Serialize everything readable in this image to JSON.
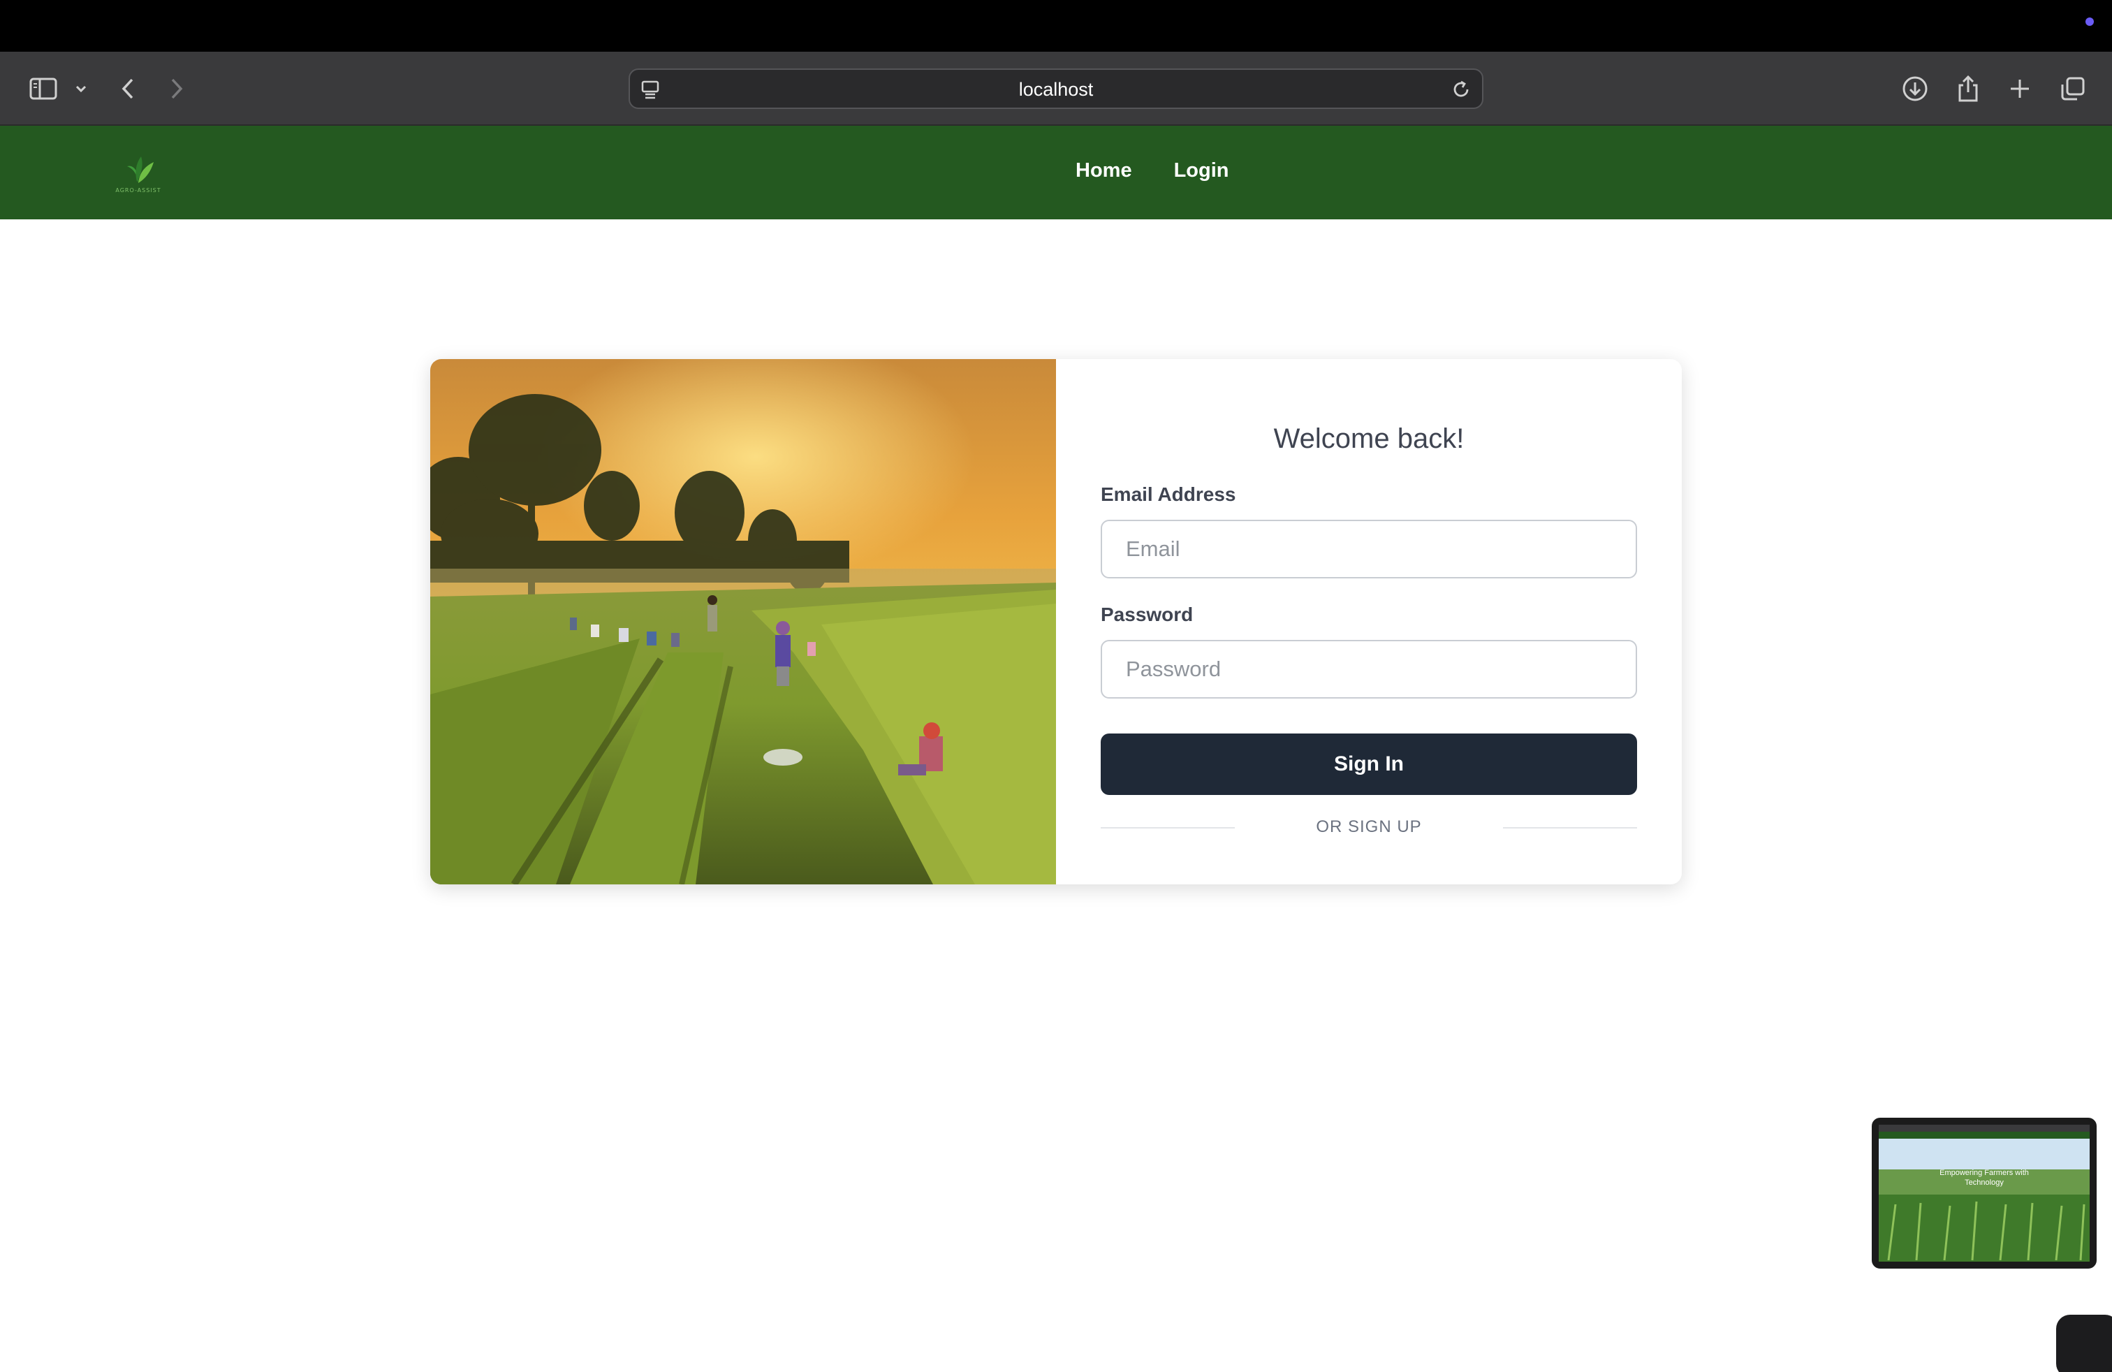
{
  "browser": {
    "url": "localhost",
    "icons": [
      "sidebar-icon",
      "chevron-down-icon",
      "back-icon",
      "forward-icon",
      "page-settings-icon",
      "reload-icon",
      "download-icon",
      "share-icon",
      "new-tab-icon",
      "tabs-overview-icon"
    ]
  },
  "navbar": {
    "logo_text": "AGRO-ASSIST",
    "links": [
      {
        "label": "Home"
      },
      {
        "label": "Login"
      }
    ],
    "color": "#245920"
  },
  "login": {
    "title": "Welcome back!",
    "email_label": "Email Address",
    "email_placeholder": "Email",
    "password_label": "Password",
    "password_placeholder": "Password",
    "signin_label": "Sign In",
    "divider_text": "OR SIGN UP",
    "button_color": "#1f2937"
  },
  "thumbnail": {
    "caption": "Empowering Farmers with Technology"
  }
}
